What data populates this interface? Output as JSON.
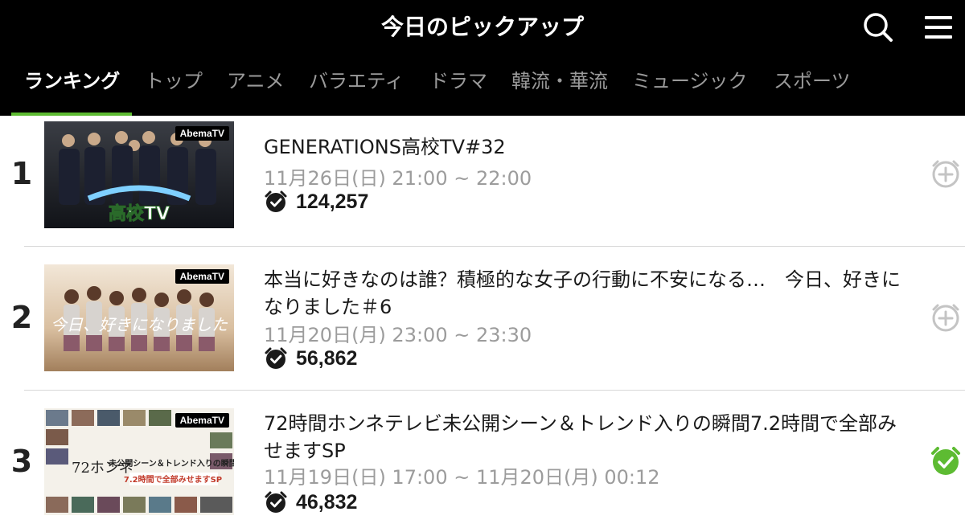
{
  "header": {
    "title": "今日のピックアップ",
    "search_icon": "search-icon",
    "menu_icon": "hamburger-menu-icon"
  },
  "tabs": [
    {
      "label": "ランキング",
      "active": true
    },
    {
      "label": "トップ"
    },
    {
      "label": "アニメ"
    },
    {
      "label": "バラエティ"
    },
    {
      "label": "ドラマ"
    },
    {
      "label": "韓流・華流"
    },
    {
      "label": "ミュージック"
    },
    {
      "label": "スポーツ"
    }
  ],
  "colors": {
    "accent_green": "#5dbb32",
    "header_bg": "#000000",
    "tab_inactive": "#9a9a9a",
    "reminder_inactive": "#c4c4c4"
  },
  "items": [
    {
      "rank": "1",
      "title": "GENERATIONS高校TV#32",
      "time": "11月26日(日) 21:00 ~ 22:00",
      "count": "124,257",
      "reminder_set": false,
      "badge": "AbemaTV"
    },
    {
      "rank": "2",
      "title": "本当に好きなのは誰？積極的な女子の行動に不安になる…　今日、好きになりました＃6",
      "time": "11月20日(月) 23:00 ~ 23:30",
      "count": "56,862",
      "reminder_set": false,
      "badge": "AbemaTV"
    },
    {
      "rank": "3",
      "title": "72時間ホンネテレビ未公開シーン＆トレンド入りの瞬間7.2時間で全部みせますSP",
      "time": "11月19日(日) 17:00 ~ 11月20日(月) 00:12",
      "count": "46,832",
      "reminder_set": true,
      "badge": "AbemaTV"
    }
  ]
}
